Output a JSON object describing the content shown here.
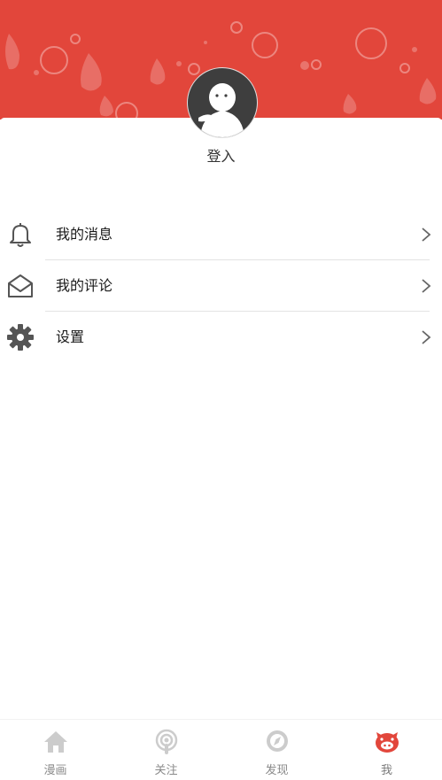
{
  "header": {
    "background": "#e2463b"
  },
  "profile": {
    "login_label": "登入"
  },
  "menu": {
    "items": [
      {
        "label": "我的消息",
        "icon": "bell-icon"
      },
      {
        "label": "我的评论",
        "icon": "mail-open-icon"
      },
      {
        "label": "设置",
        "icon": "gear-icon"
      }
    ]
  },
  "tabbar": {
    "tabs": [
      {
        "label": "漫画",
        "icon": "home-icon"
      },
      {
        "label": "关注",
        "icon": "podcast-icon"
      },
      {
        "label": "发现",
        "icon": "compass-icon"
      },
      {
        "label": "我",
        "icon": "pig-face-icon",
        "active": true
      }
    ],
    "active_color": "#e2463b",
    "inactive_color": "#c9c9c9"
  }
}
